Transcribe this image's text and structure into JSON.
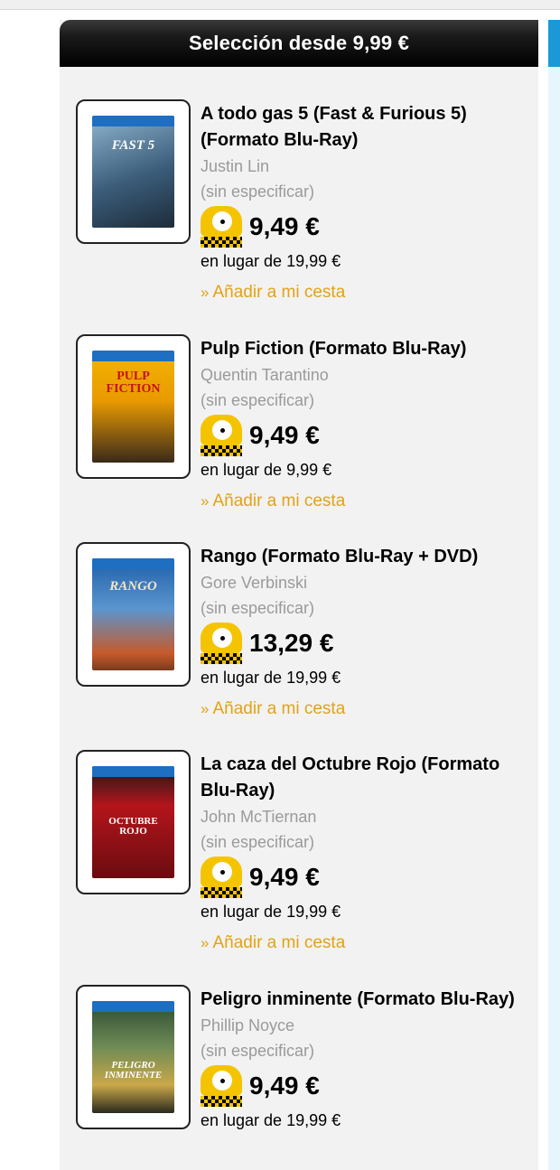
{
  "section": {
    "header": "Selección desde 9,99 €"
  },
  "products": [
    {
      "title": "A todo gas 5 (Fast & Furious 5) (Formato Blu-Ray)",
      "director": "Justin Lin",
      "meta": "(sin especificar)",
      "price": "9,49 €",
      "was": "en lugar de 19,99 €",
      "add": "Añadir a mi cesta",
      "cover_text": "FAST 5"
    },
    {
      "title": "Pulp Fiction (Formato Blu-Ray)",
      "director": "Quentin Tarantino",
      "meta": "(sin especificar)",
      "price": "9,49 €",
      "was": "en lugar de 9,99 €",
      "add": "Añadir a mi cesta",
      "cover_text": "PULP FICTION"
    },
    {
      "title": "Rango (Formato Blu-Ray + DVD)",
      "director": "Gore Verbinski",
      "meta": "(sin especificar)",
      "price": "13,29 €",
      "was": "en lugar de 19,99 €",
      "add": "Añadir a mi cesta",
      "cover_text": "RANGO"
    },
    {
      "title": "La caza del Octubre Rojo (Formato Blu-Ray)",
      "director": "John McTiernan",
      "meta": "(sin especificar)",
      "price": "9,49 €",
      "was": "en lugar de 19,99 €",
      "add": "Añadir a mi cesta",
      "cover_text": "OCTUBRE ROJO"
    },
    {
      "title": "Peligro inminente (Formato Blu-Ray)",
      "director": "Phillip Noyce",
      "meta": "(sin especificar)",
      "price": "9,49 €",
      "was": "en lugar de 19,99 €",
      "cover_text": "PELIGRO INMINENTE"
    }
  ],
  "icons": {
    "add_link_prefix": "»",
    "price_badge": "price-badge-icon"
  },
  "colors": {
    "header_bg": "#000000",
    "accent_blue": "#1a99d6",
    "link_orange": "#e3a214",
    "badge_yellow": "#f5c400"
  }
}
